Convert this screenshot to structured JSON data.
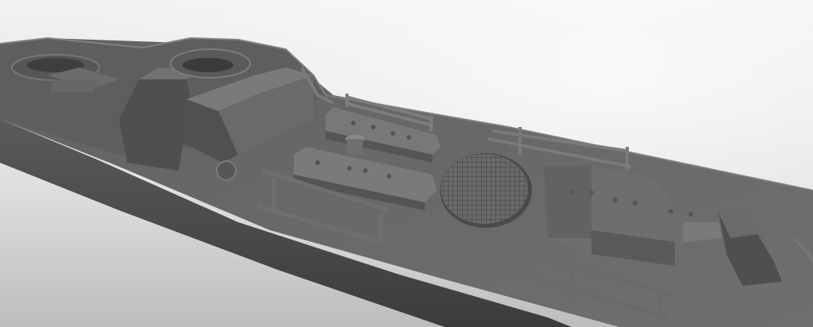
{
  "scene": {
    "subject": "ship-deck-3d-render",
    "colors": {
      "background_light": "#f4f4f4",
      "background_mid": "#d9d9d9",
      "background_dark": "#b8b8b8",
      "hull": "#5f5f5f",
      "hull_dark": "#3f3f3f",
      "deck": "#6b6b6b",
      "deck_shadow": "#555555",
      "highlight": "#8a8a8a",
      "detail": "#7a7a7a"
    }
  }
}
